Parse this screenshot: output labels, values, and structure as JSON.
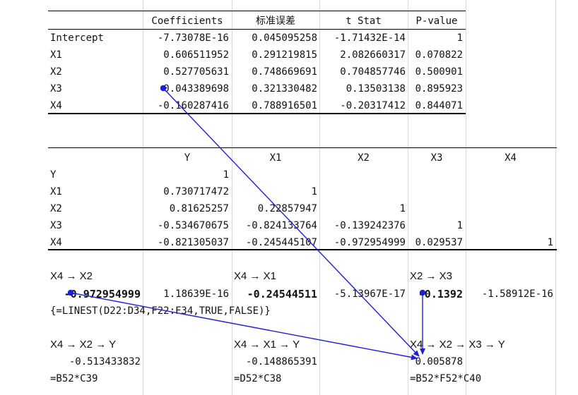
{
  "regression": {
    "headers": [
      "",
      "Coefficients",
      "标准误差",
      "t Stat",
      "P-value"
    ],
    "rows": [
      [
        "Intercept",
        "-7.73078E-16",
        "0.045095258",
        "-1.71432E-14",
        "1"
      ],
      [
        "X1",
        "0.606511952",
        "0.291219815",
        "2.082660317",
        "0.070822"
      ],
      [
        "X2",
        "0.527705631",
        "0.748669691",
        "0.704857746",
        "0.500901"
      ],
      [
        "X3",
        "0.043389698",
        "0.321330482",
        "0.13503138",
        "0.895923"
      ],
      [
        "X4",
        "-0.160287416",
        "0.788916501",
        "-0.20317412",
        "0.844071"
      ]
    ]
  },
  "correlation": {
    "headers": [
      "",
      "Y",
      "X1",
      "X2",
      "X3",
      "X4"
    ],
    "rows": [
      [
        "Y",
        "1",
        "",
        "",
        "",
        ""
      ],
      [
        "X1",
        "0.730717472",
        "1",
        "",
        "",
        ""
      ],
      [
        "X2",
        "0.81625257",
        "0.22857947",
        "1",
        "",
        ""
      ],
      [
        "X3",
        "-0.534670675",
        "-0.824133764",
        "-0.139242376",
        "1",
        ""
      ],
      [
        "X4",
        "-0.821305037",
        "-0.245445107",
        "-0.972954999",
        "0.029537",
        "1"
      ]
    ]
  },
  "paths": {
    "p1_label": "X4 → X2",
    "p2_label": "X4 → X1",
    "p3_label": "X2 → X3",
    "p1_coef": "-0.972954999",
    "p1_int": "1.18639E-16",
    "p2_coef": "-0.24544511",
    "p2_int": "-5.13967E-17",
    "p3_coef": "-0.1392",
    "p3_int": "-1.58912E-16",
    "formula": "{=LINEST(D22:D34,F22:F34,TRUE,FALSE)}",
    "q1_label": "X4 → X2 → Y",
    "q2_label": "X4 → X1 → Y",
    "q3_label": "X4 → X2 → X3 → Y",
    "q1_val": "-0.513433832",
    "q2_val": "-0.148865391",
    "q3_val": "0.005878",
    "q1_formula": "=B52*C39",
    "q2_formula": "=D52*C38",
    "q3_formula": "=B52*F52*C40"
  },
  "arrow_color": "#1f1fd6"
}
